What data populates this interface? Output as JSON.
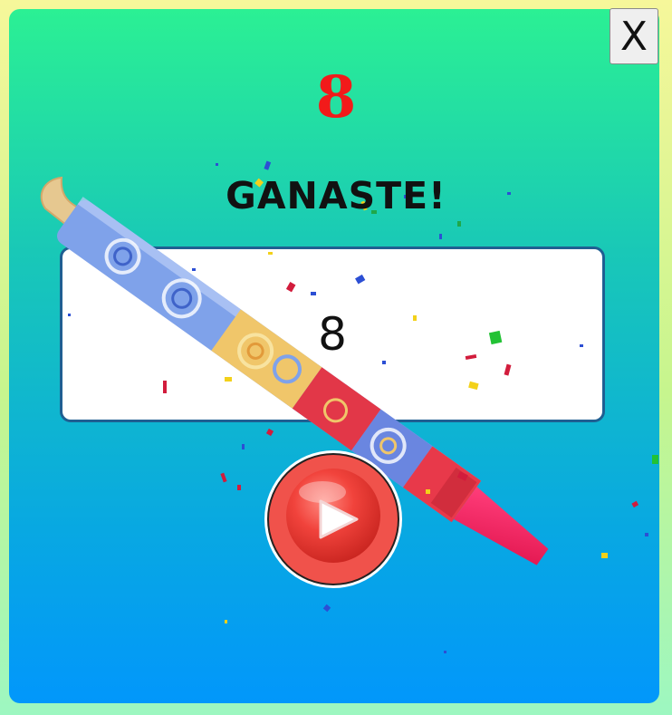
{
  "dialog": {
    "close_label": "X",
    "score": "8",
    "message": "GANASTE!",
    "result_value": "8"
  },
  "icons": {
    "close": "close-icon",
    "play": "play-icon",
    "party_blower": "party-blower-icon"
  },
  "colors": {
    "score": "#f21a1a",
    "result_border": "#1f5f92",
    "play_button": "#e8413c",
    "panel_top": "#2bf094",
    "panel_bottom": "#0297fb"
  }
}
